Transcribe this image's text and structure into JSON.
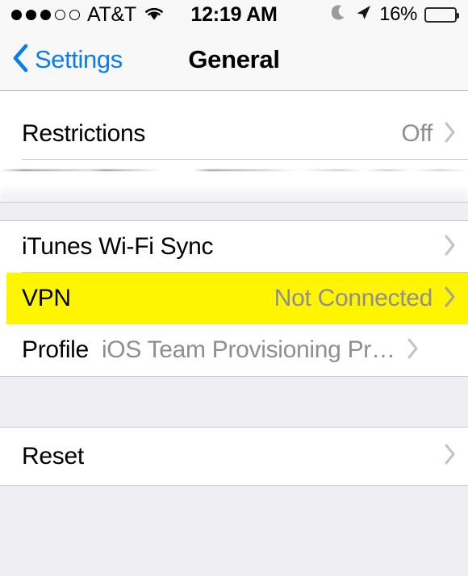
{
  "status_bar": {
    "signal_dots_filled": 3,
    "signal_dots_empty": 2,
    "carrier": "AT&T",
    "wifi_icon": "wifi-icon",
    "time": "12:19 AM",
    "do_not_disturb_icon": "moon-icon",
    "location_icon": "location-arrow-icon",
    "battery_percent": "16%",
    "battery_level": 16,
    "battery_color": "#f03c34"
  },
  "nav_bar": {
    "back_icon": "chevron-left-icon",
    "back_label": "Settings",
    "title": "General",
    "tint_color": "#0a7cf0"
  },
  "sections": [
    {
      "rows": [
        {
          "label": "Restrictions",
          "value": "Off",
          "chevron": true,
          "highlighted": false
        }
      ]
    },
    {
      "rows": [
        {
          "label": "iTunes Wi-Fi Sync",
          "value": "",
          "chevron": true,
          "highlighted": false
        },
        {
          "label": "VPN",
          "value": "Not Connected",
          "chevron": true,
          "highlighted": true
        },
        {
          "label": "Profile",
          "value": "iOS Team Provisioning Pr…",
          "chevron": true,
          "highlighted": false,
          "inline_value": true
        }
      ]
    },
    {
      "rows": [
        {
          "label": "Reset",
          "value": "",
          "chevron": true,
          "highlighted": false
        }
      ]
    }
  ],
  "colors": {
    "highlight": "#fff500",
    "group_background": "#eeeef3",
    "row_background": "#ffffff",
    "separator": "#c8c7cc",
    "secondary_text": "#8e8e93"
  }
}
